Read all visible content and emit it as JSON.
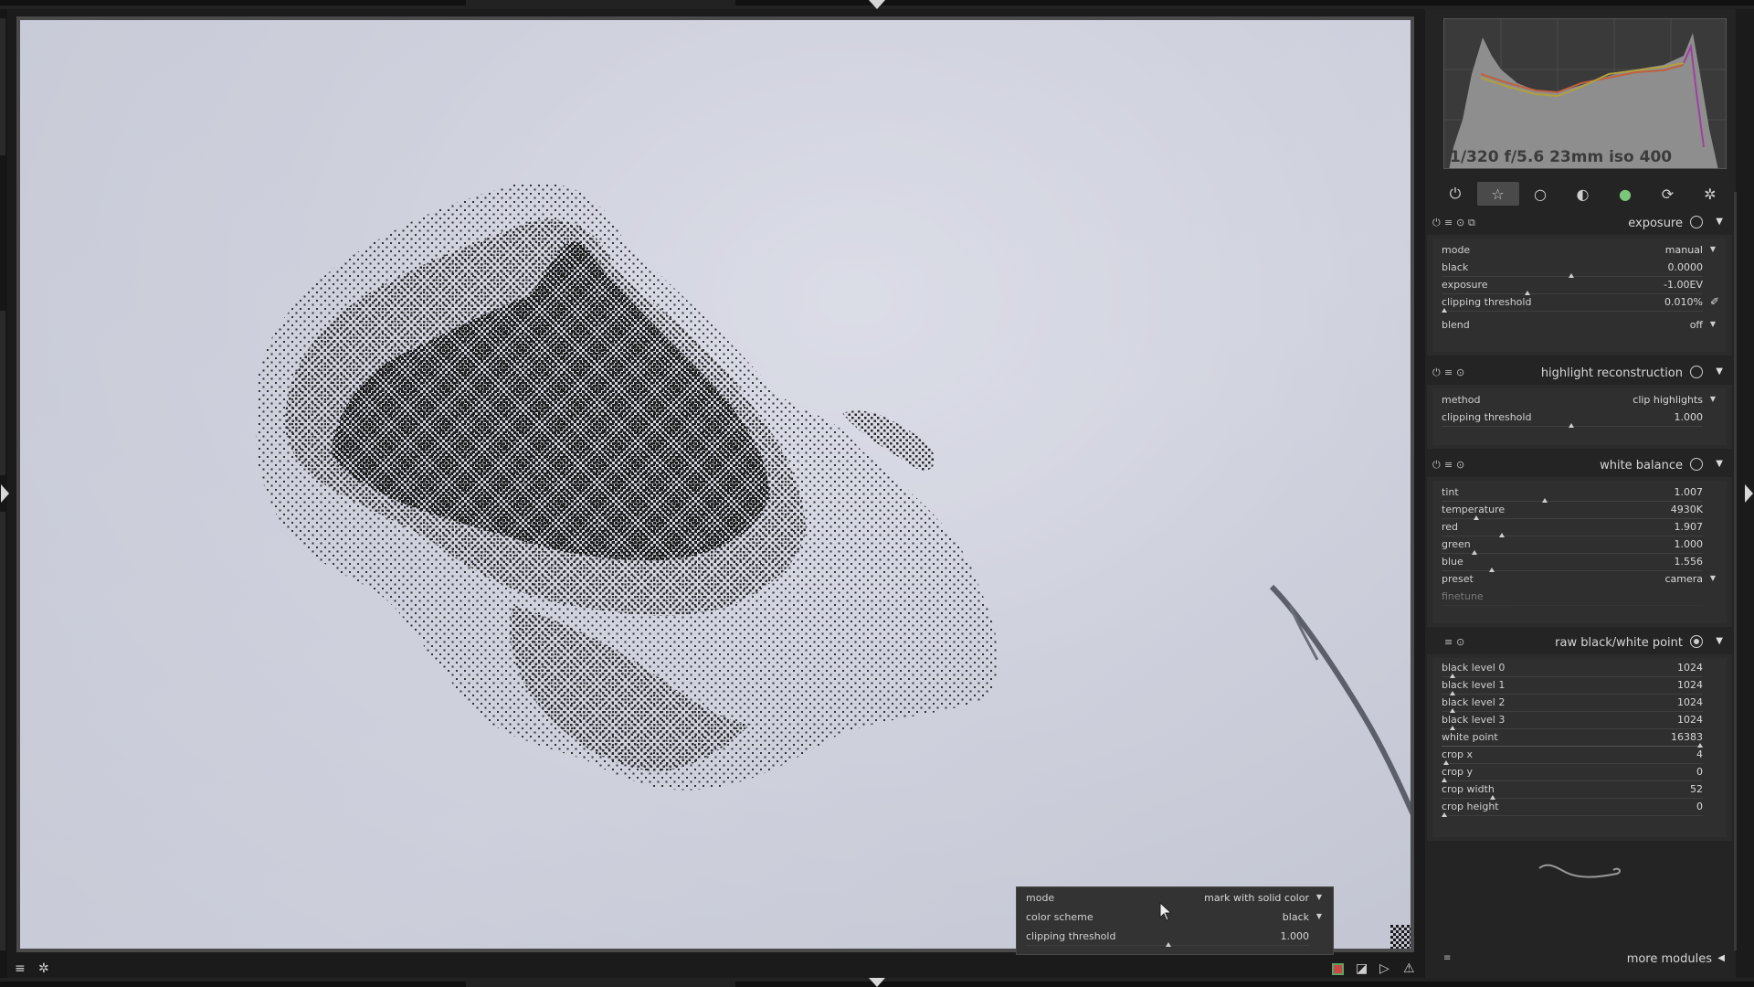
{
  "histogram": {
    "info": "1/320 f/5.6 23mm iso 400"
  },
  "module_groups": [
    {
      "icon": "power-icon",
      "glyph": "⏻"
    },
    {
      "icon": "star-icon",
      "glyph": "☆"
    },
    {
      "icon": "circle-icon",
      "glyph": "○"
    },
    {
      "icon": "tone-icon",
      "glyph": "◐"
    },
    {
      "icon": "color-icon",
      "glyph": "●"
    },
    {
      "icon": "correct-icon",
      "glyph": "⟳"
    },
    {
      "icon": "effects-icon",
      "glyph": "✲"
    }
  ],
  "exposure": {
    "title": "exposure",
    "mode_label": "mode",
    "mode_value": "manual",
    "black_label": "black",
    "black_value": "0.0000",
    "exposure_label": "exposure",
    "exposure_value": "-1.00EV",
    "clip_label": "clipping threshold",
    "clip_value": "0.010%",
    "blend_label": "blend",
    "blend_value": "off"
  },
  "highlight": {
    "title": "highlight reconstruction",
    "method_label": "method",
    "method_value": "clip highlights",
    "clip_label": "clipping threshold",
    "clip_value": "1.000"
  },
  "white_balance": {
    "title": "white balance",
    "tint_label": "tint",
    "tint_value": "1.007",
    "temp_label": "temperature",
    "temp_value": "4930K",
    "red_label": "red",
    "red_value": "1.907",
    "green_label": "green",
    "green_value": "1.000",
    "blue_label": "blue",
    "blue_value": "1.556",
    "preset_label": "preset",
    "preset_value": "camera",
    "finetune_label": "finetune"
  },
  "rawbw": {
    "title": "raw black/white point",
    "rows": [
      {
        "label": "black level 0",
        "value": "1024"
      },
      {
        "label": "black level 1",
        "value": "1024"
      },
      {
        "label": "black level 2",
        "value": "1024"
      },
      {
        "label": "black level 3",
        "value": "1024"
      },
      {
        "label": "white point",
        "value": "16383"
      },
      {
        "label": "crop x",
        "value": "4"
      },
      {
        "label": "crop y",
        "value": "0"
      },
      {
        "label": "crop width",
        "value": "52"
      },
      {
        "label": "crop height",
        "value": "0"
      }
    ]
  },
  "more_modules": "more modules",
  "overlay": {
    "mode_label": "mode",
    "mode_value": "mark with solid color",
    "scheme_label": "color scheme",
    "scheme_value": "black",
    "clip_label": "clipping threshold",
    "clip_value": "1.000"
  }
}
